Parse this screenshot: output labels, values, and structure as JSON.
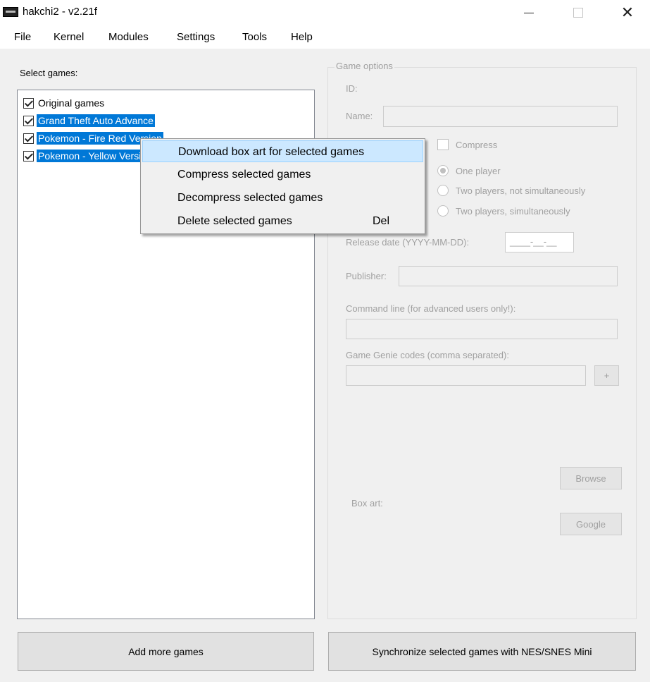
{
  "window": {
    "title": "hakchi2 - v2.21f"
  },
  "menu": [
    "File",
    "Kernel",
    "Modules",
    "Settings",
    "Tools",
    "Help"
  ],
  "left": {
    "select_label": "Select games:",
    "games": [
      {
        "name": "Original games",
        "checked": true,
        "selected": false
      },
      {
        "name": "Grand Theft Auto Advance",
        "checked": true,
        "selected": true
      },
      {
        "name": "Pokemon - Fire Red Version",
        "checked": true,
        "selected": true
      },
      {
        "name": "Pokemon - Yellow Version",
        "checked": true,
        "selected": true
      }
    ]
  },
  "options": {
    "title": "Game options",
    "id_label": "ID:",
    "name_label": "Name:",
    "compress_label": "Compress",
    "one_player": "One player",
    "two_not_sim": "Two players, not simultaneously",
    "two_sim": "Two players, simultaneously",
    "release_label": "Release date (YYYY-MM-DD):",
    "release_value": "____-__-__",
    "publisher_label": "Publisher:",
    "cmdline_label": "Command line (for advanced users only!):",
    "genie_label": "Game Genie codes (comma separated):",
    "plus": "+",
    "browse": "Browse",
    "boxart_label": "Box art:",
    "google": "Google"
  },
  "buttons": {
    "add_games": "Add more games",
    "sync": "Synchronize selected games with NES/SNES Mini"
  },
  "context_menu": [
    {
      "label": "Download box art for selected games",
      "shortcut": ""
    },
    {
      "label": "Compress selected games",
      "shortcut": ""
    },
    {
      "label": "Decompress selected games",
      "shortcut": ""
    },
    {
      "label": "Delete selected games",
      "shortcut": "Del"
    }
  ]
}
